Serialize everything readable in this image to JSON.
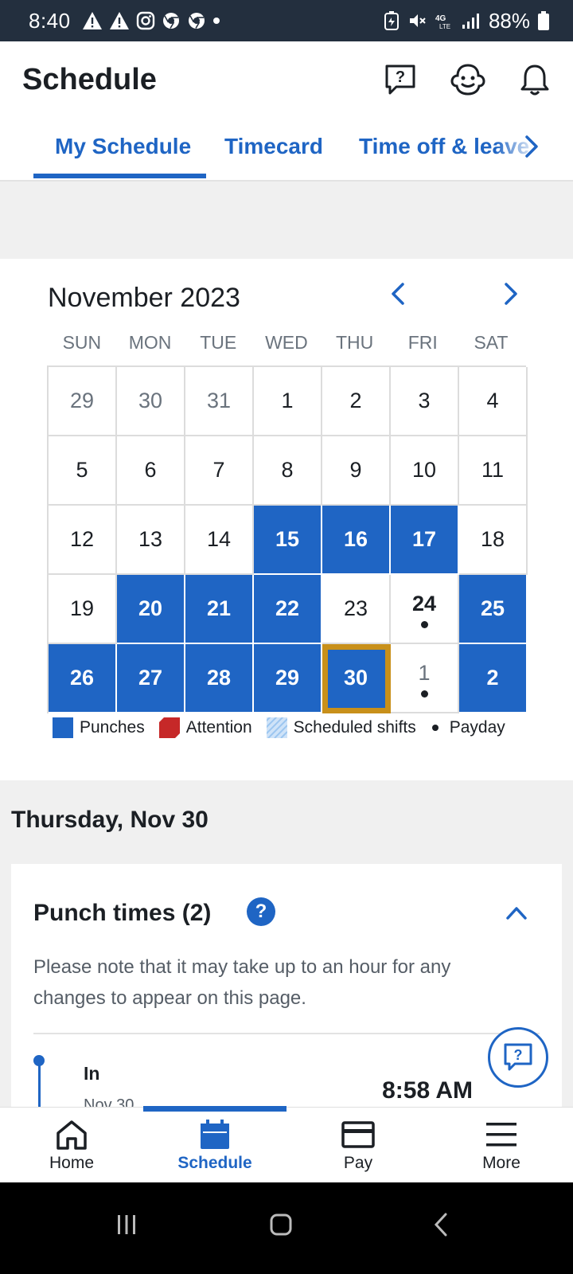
{
  "status_bar": {
    "time": "8:40",
    "battery": "88%"
  },
  "header": {
    "title": "Schedule"
  },
  "tabs": [
    {
      "label": "My Schedule",
      "active": true
    },
    {
      "label": "Timecard",
      "active": false
    },
    {
      "label": "Time off & leave",
      "active": false
    }
  ],
  "calendar": {
    "month_label": "November 2023",
    "weekdays": [
      "SUN",
      "MON",
      "TUE",
      "WED",
      "THU",
      "FRI",
      "SAT"
    ],
    "weeks": [
      [
        {
          "d": "29",
          "m": true
        },
        {
          "d": "30",
          "m": true
        },
        {
          "d": "31",
          "m": true
        },
        {
          "d": "1"
        },
        {
          "d": "2"
        },
        {
          "d": "3"
        },
        {
          "d": "4"
        }
      ],
      [
        {
          "d": "5"
        },
        {
          "d": "6"
        },
        {
          "d": "7"
        },
        {
          "d": "8"
        },
        {
          "d": "9"
        },
        {
          "d": "10"
        },
        {
          "d": "11"
        }
      ],
      [
        {
          "d": "12"
        },
        {
          "d": "13"
        },
        {
          "d": "14"
        },
        {
          "d": "15",
          "p": true
        },
        {
          "d": "16",
          "p": true
        },
        {
          "d": "17",
          "p": true
        },
        {
          "d": "18"
        }
      ],
      [
        {
          "d": "19"
        },
        {
          "d": "20",
          "p": true
        },
        {
          "d": "21",
          "p": true
        },
        {
          "d": "22",
          "p": true
        },
        {
          "d": "23"
        },
        {
          "d": "24",
          "pay": true
        },
        {
          "d": "25",
          "p": true
        }
      ],
      [
        {
          "d": "26",
          "p": true
        },
        {
          "d": "27",
          "p": true
        },
        {
          "d": "28",
          "p": true
        },
        {
          "d": "29",
          "p": true
        },
        {
          "d": "30",
          "p": true,
          "today": true
        },
        {
          "d": "1",
          "m": true,
          "pay": true
        },
        {
          "d": "2",
          "p": true
        }
      ]
    ],
    "legend": {
      "punches": "Punches",
      "attention": "Attention",
      "scheduled": "Scheduled shifts",
      "payday": "Payday"
    },
    "colors": {
      "punch": "#1f65c4",
      "attention": "#c62828",
      "scheduled": "#b9d8f7",
      "today_outline": "#c8901a"
    }
  },
  "selected_day": {
    "heading": "Thursday, Nov 30",
    "punch_card": {
      "title": "Punch times (2)",
      "help": "?",
      "note": "Please note that it may take up to an hour for any changes to appear on this page.",
      "punches": [
        {
          "type": "In",
          "date": "Nov 30",
          "time": "8:58 AM"
        }
      ]
    }
  },
  "bottom_nav": [
    {
      "label": "Home",
      "icon": "home-icon",
      "active": false
    },
    {
      "label": "Schedule",
      "icon": "calendar-icon",
      "active": true
    },
    {
      "label": "Pay",
      "icon": "wallet-icon",
      "active": false
    },
    {
      "label": "More",
      "icon": "menu-icon",
      "active": false
    }
  ]
}
